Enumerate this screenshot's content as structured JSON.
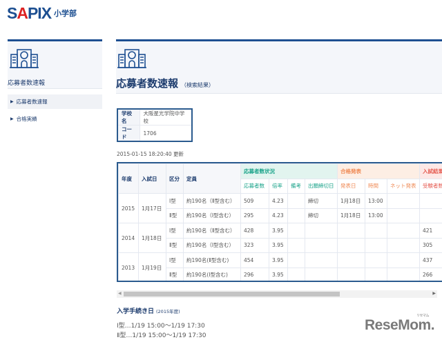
{
  "logo": {
    "brand": "SAPIX",
    "sub": "小学部"
  },
  "sidebar": {
    "title": "応募者数速報",
    "items": [
      {
        "label": "応募者数速報"
      },
      {
        "label": "合格実績"
      }
    ]
  },
  "main": {
    "title": "応募者数速報",
    "subtitle": "（検索結果）"
  },
  "school": {
    "name_label": "学校名",
    "name": "大阪星光学院中学校",
    "code_label": "コード",
    "code": "1706"
  },
  "updated": "2015-01-15 18:20:40 更新",
  "table": {
    "headers": {
      "year": "年度",
      "date": "入試日",
      "type": "区分",
      "capacity": "定員",
      "group_apply": "応募者数状況",
      "group_pass": "合格発表",
      "group_result": "入試結果"
    },
    "subheaders": {
      "applicants": "応募者数",
      "ratio": "倍率",
      "note": "備考",
      "deadline": "出願締切日",
      "announce_date": "発表日",
      "time": "時間",
      "net": "ネット発表",
      "examinees": "受験者数"
    },
    "rows": [
      {
        "year": "2015",
        "date": "1月17日",
        "type": "Ⅰ型",
        "capacity": "約190名（Ⅱ型含む）",
        "applicants": "509",
        "ratio": "4.23",
        "note": "",
        "deadline": "締切",
        "announce": "1月18日",
        "time": "13:00",
        "net": "",
        "examinees": ""
      },
      {
        "type": "Ⅱ型",
        "capacity": "約190名（Ⅰ型含む）",
        "applicants": "295",
        "ratio": "4.23",
        "note": "",
        "deadline": "締切",
        "announce": "1月18日",
        "time": "13:00",
        "net": "",
        "examinees": ""
      },
      {
        "year": "2014",
        "date": "1月18日",
        "type": "Ⅰ型",
        "capacity": "約190名（Ⅱ型含む）",
        "applicants": "428",
        "ratio": "3.95",
        "note": "",
        "deadline": "",
        "announce": "",
        "time": "",
        "net": "",
        "examinees": "421"
      },
      {
        "type": "Ⅱ型",
        "capacity": "約190名（Ⅰ型含む）",
        "applicants": "323",
        "ratio": "3.95",
        "note": "",
        "deadline": "",
        "announce": "",
        "time": "",
        "net": "",
        "examinees": "305"
      },
      {
        "year": "2013",
        "date": "1月19日",
        "type": "Ⅰ型",
        "capacity": "約190名(Ⅱ型含む)",
        "applicants": "454",
        "ratio": "3.95",
        "note": "",
        "deadline": "",
        "announce": "",
        "time": "",
        "net": "",
        "examinees": "437"
      },
      {
        "type": "Ⅱ型",
        "capacity": "約190名(Ⅰ型含む)",
        "applicants": "296",
        "ratio": "3.95",
        "note": "",
        "deadline": "",
        "announce": "",
        "time": "",
        "net": "",
        "examinees": "266"
      }
    ]
  },
  "procedure": {
    "title": "入学手続き日",
    "year": "(2015年度)",
    "lines": [
      "Ⅰ型…1/19 15:00～1/19 17:30",
      "Ⅱ型…1/19 15:00～1/19 17:30"
    ]
  },
  "watermark": {
    "text": "ReseMom.",
    "ruby": "リセマム"
  }
}
